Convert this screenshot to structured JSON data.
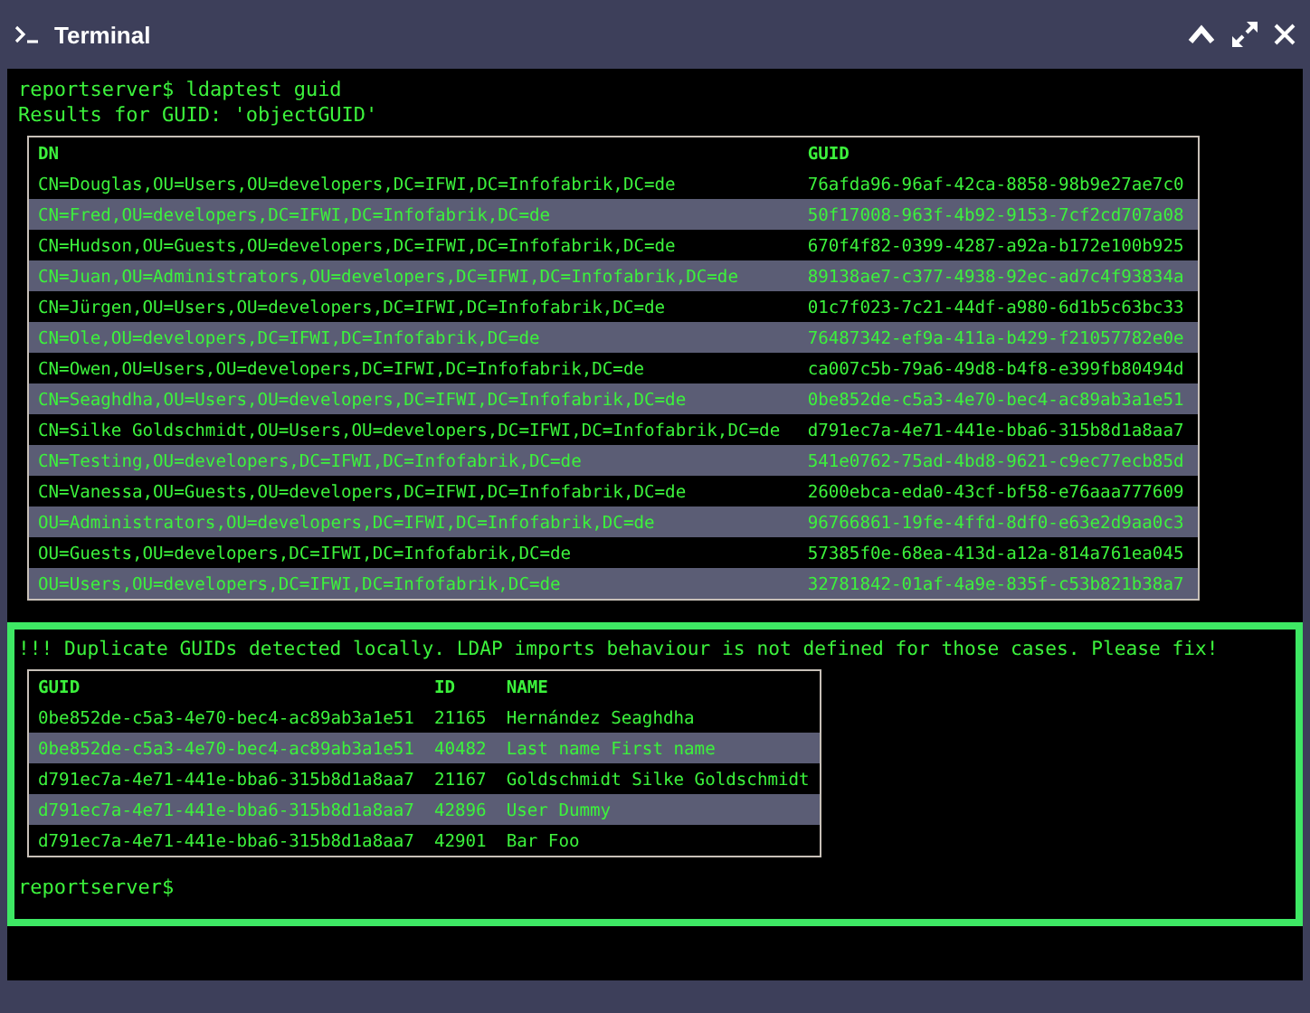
{
  "window": {
    "title": "Terminal"
  },
  "lines": [
    "reportserver$ ldaptest guid",
    "Results for GUID: 'objectGUID'"
  ],
  "results_table": {
    "columns": [
      "DN",
      "GUID"
    ],
    "rows": [
      [
        "CN=Douglas,OU=Users,OU=developers,DC=IFWI,DC=Infofabrik,DC=de",
        "76afda96-96af-42ca-8858-98b9e27ae7c0"
      ],
      [
        "CN=Fred,OU=developers,DC=IFWI,DC=Infofabrik,DC=de",
        "50f17008-963f-4b92-9153-7cf2cd707a08"
      ],
      [
        "CN=Hudson,OU=Guests,OU=developers,DC=IFWI,DC=Infofabrik,DC=de",
        "670f4f82-0399-4287-a92a-b172e100b925"
      ],
      [
        "CN=Juan,OU=Administrators,OU=developers,DC=IFWI,DC=Infofabrik,DC=de",
        "89138ae7-c377-4938-92ec-ad7c4f93834a"
      ],
      [
        "CN=Jürgen,OU=Users,OU=developers,DC=IFWI,DC=Infofabrik,DC=de",
        "01c7f023-7c21-44df-a980-6d1b5c63bc33"
      ],
      [
        "CN=Ole,OU=developers,DC=IFWI,DC=Infofabrik,DC=de",
        "76487342-ef9a-411a-b429-f21057782e0e"
      ],
      [
        "CN=Owen,OU=Users,OU=developers,DC=IFWI,DC=Infofabrik,DC=de",
        "ca007c5b-79a6-49d8-b4f8-e399fb80494d"
      ],
      [
        "CN=Seaghdha,OU=Users,OU=developers,DC=IFWI,DC=Infofabrik,DC=de",
        "0be852de-c5a3-4e70-bec4-ac89ab3a1e51"
      ],
      [
        "CN=Silke Goldschmidt,OU=Users,OU=developers,DC=IFWI,DC=Infofabrik,DC=de",
        "d791ec7a-4e71-441e-bba6-315b8d1a8aa7"
      ],
      [
        "CN=Testing,OU=developers,DC=IFWI,DC=Infofabrik,DC=de",
        "541e0762-75ad-4bd8-9621-c9ec77ecb85d"
      ],
      [
        "CN=Vanessa,OU=Guests,OU=developers,DC=IFWI,DC=Infofabrik,DC=de",
        "2600ebca-eda0-43cf-bf58-e76aaa777609"
      ],
      [
        "OU=Administrators,OU=developers,DC=IFWI,DC=Infofabrik,DC=de",
        "96766861-19fe-4ffd-8df0-e63e2d9aa0c3"
      ],
      [
        "OU=Guests,OU=developers,DC=IFWI,DC=Infofabrik,DC=de",
        "57385f0e-68ea-413d-a12a-814a761ea045"
      ],
      [
        "OU=Users,OU=developers,DC=IFWI,DC=Infofabrik,DC=de",
        "32781842-01af-4a9e-835f-c53b821b38a7"
      ]
    ]
  },
  "warning": {
    "message": "!!! Duplicate GUIDs detected locally. LDAP imports behaviour is not defined for those cases. Please fix!",
    "table": {
      "columns": [
        "GUID",
        "ID",
        "NAME"
      ],
      "rows": [
        [
          "0be852de-c5a3-4e70-bec4-ac89ab3a1e51",
          "21165",
          "Hernández Seaghdha"
        ],
        [
          "0be852de-c5a3-4e70-bec4-ac89ab3a1e51",
          "40482",
          "Last name First name"
        ],
        [
          "d791ec7a-4e71-441e-bba6-315b8d1a8aa7",
          "21167",
          "Goldschmidt Silke Goldschmidt"
        ],
        [
          "d791ec7a-4e71-441e-bba6-315b8d1a8aa7",
          "42896",
          "User Dummy"
        ],
        [
          "d791ec7a-4e71-441e-bba6-315b8d1a8aa7",
          "42901",
          "Bar Foo"
        ]
      ]
    },
    "prompt": "reportserver$"
  }
}
